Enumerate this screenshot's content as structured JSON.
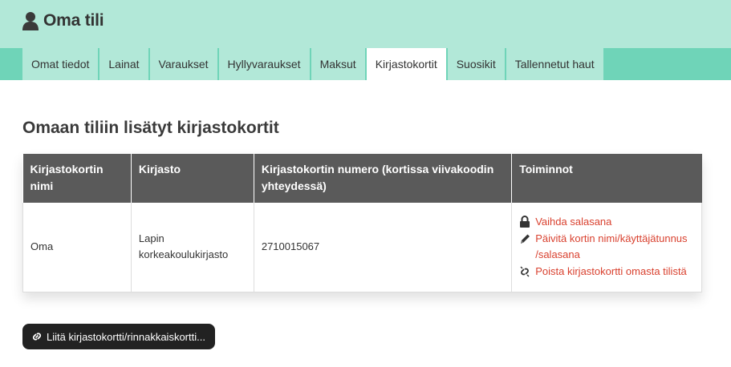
{
  "header": {
    "title": "Oma tili",
    "icon": "user-icon"
  },
  "tabs": [
    {
      "label": "Omat tiedot",
      "active": false
    },
    {
      "label": "Lainat",
      "active": false
    },
    {
      "label": "Varaukset",
      "active": false
    },
    {
      "label": "Hyllyvaraukset",
      "active": false
    },
    {
      "label": "Maksut",
      "active": false
    },
    {
      "label": "Kirjastokortit",
      "active": true
    },
    {
      "label": "Suosikit",
      "active": false
    },
    {
      "label": "Tallennetut haut",
      "active": false
    }
  ],
  "section_title": "Omaan tiliin lisätyt kirjastokortit",
  "table": {
    "headers": {
      "name": "Kirjastokortin nimi",
      "library": "Kirjasto",
      "number": "Kirjastokortin numero (kortissa viivakoodin yhteydessä)",
      "actions": "Toiminnot"
    },
    "rows": [
      {
        "name": "Oma",
        "library": "Lapin korkeakoulukirjasto",
        "number": "2710015067",
        "actions": {
          "change_password": "Vaihda salasana",
          "update_card": "Päivitä kortin nimi/käyttäjätunnus /salasana",
          "remove_card": "Poista kirjastokortti omasta tilistä"
        }
      }
    ]
  },
  "link_button": {
    "label": "Liitä kirjastokortti/rinnakkaiskortti...",
    "icon": "link-icon"
  },
  "colors": {
    "header_bg": "#b2e8d8",
    "tab_bar_bg": "#6fd4b8",
    "table_header_bg": "#5a5a5a",
    "action_link": "#d9412f",
    "button_bg": "#222222"
  }
}
